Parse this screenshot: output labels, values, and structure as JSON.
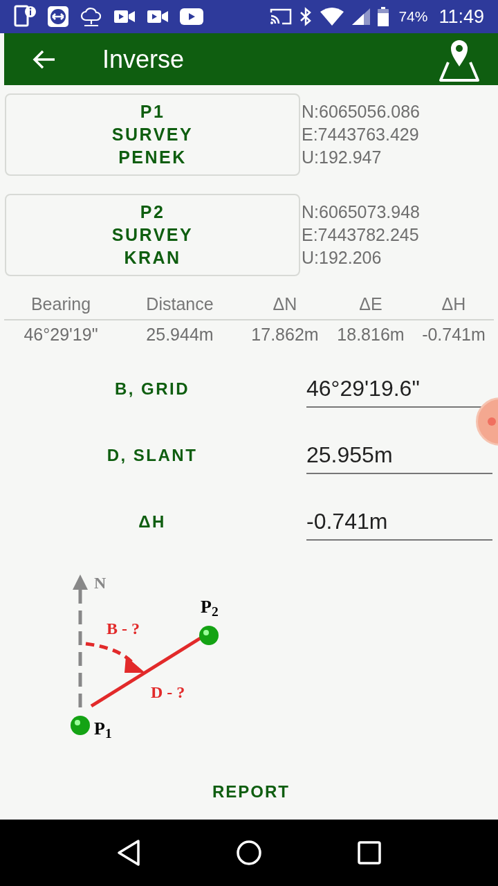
{
  "status_bar": {
    "battery": "74%",
    "time": "11:49"
  },
  "app_bar": {
    "title": "Inverse"
  },
  "points": [
    {
      "lines": [
        "P1",
        "SURVEY",
        "PENEK"
      ],
      "coords": [
        "N:6065056.086",
        "E:7443763.429",
        "U:192.947"
      ]
    },
    {
      "lines": [
        "P2",
        "SURVEY",
        "KRAN"
      ],
      "coords": [
        "N:6065073.948",
        "E:7443782.245",
        "U:192.206"
      ]
    }
  ],
  "table": {
    "columns": [
      "Bearing",
      "Distance",
      "ΔN",
      "ΔE",
      "ΔH"
    ],
    "rows": [
      [
        "46°29'19\"",
        "25.944m",
        "17.862m",
        "18.816m",
        "-0.741m"
      ]
    ]
  },
  "fields": [
    {
      "label": "B, GRID",
      "value": "46°29'19.6\""
    },
    {
      "label": "D, SLANT",
      "value": "25.955m"
    },
    {
      "label": "ΔH",
      "value": "-0.741m"
    }
  ],
  "diagram": {
    "north": "N",
    "bearing": "B - ?",
    "distance": "D - ?",
    "p1": "P$_{1}$",
    "p2": "P$_{2}$"
  },
  "report_button": "REPORT"
}
